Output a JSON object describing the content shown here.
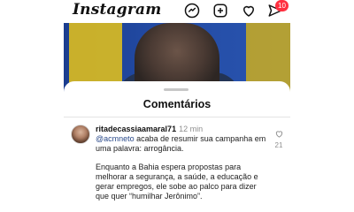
{
  "app": {
    "logo": "Instagram",
    "notifications_count": "10"
  },
  "icons": {
    "direct": "messenger-icon",
    "new_post": "plus-square-icon",
    "activity": "heart-icon",
    "send": "send-icon"
  },
  "comments_sheet": {
    "title": "Comentários",
    "comment": {
      "username": "ritadecassiaamaral71",
      "time": "12 min",
      "line1_mention": "@acmneto",
      "line1_rest": " acaba de resumir sua campanha em",
      "line2": "uma palavra: arrogância.",
      "line3": "Enquanto a Bahia espera propostas para",
      "line4": "melhorar a segurança, a saúde, a educação e",
      "line5": "gerar empregos, ele sobe ao palco para dizer",
      "line6": "que quer “humilhar Jerônimo”.",
      "likes": "21"
    }
  },
  "colors": {
    "accent_red": "#ff3040",
    "mention": "#2a4a8a",
    "muted": "#8e8e8e"
  }
}
